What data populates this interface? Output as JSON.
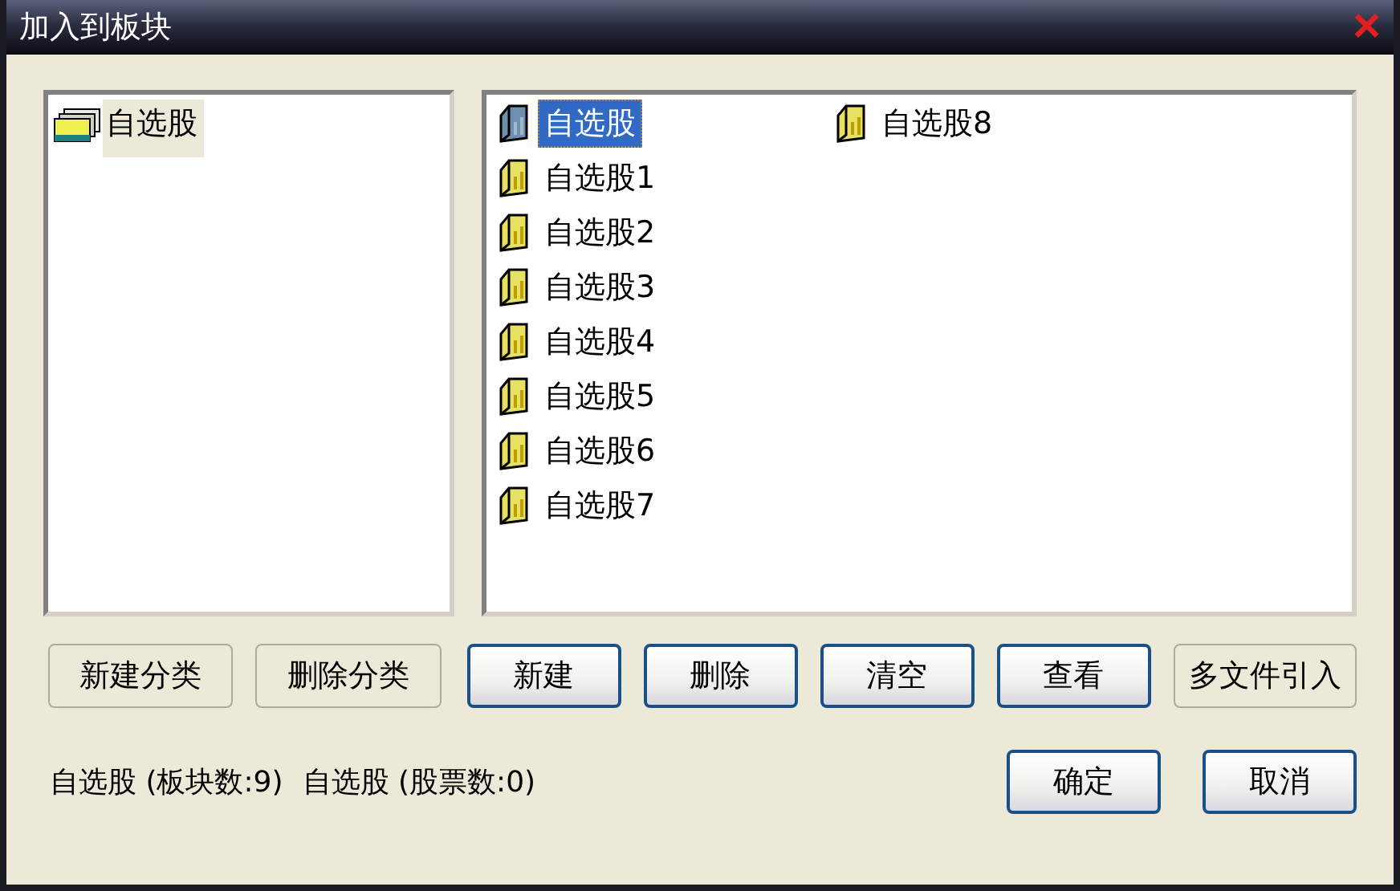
{
  "window": {
    "title": "加入到板块",
    "close": "×"
  },
  "categories": [
    {
      "label": "自选股",
      "selected": true
    }
  ],
  "blocks": [
    {
      "label": "自选股",
      "selected": true
    },
    {
      "label": "自选股1",
      "selected": false
    },
    {
      "label": "自选股2",
      "selected": false
    },
    {
      "label": "自选股3",
      "selected": false
    },
    {
      "label": "自选股4",
      "selected": false
    },
    {
      "label": "自选股5",
      "selected": false
    },
    {
      "label": "自选股6",
      "selected": false
    },
    {
      "label": "自选股7",
      "selected": false
    },
    {
      "label": "自选股8",
      "selected": false
    }
  ],
  "buttons": [
    {
      "label": "新建分类",
      "kind": "flat"
    },
    {
      "label": "删除分类",
      "kind": "flat"
    },
    {
      "label": "新建",
      "kind": "raised"
    },
    {
      "label": "删除",
      "kind": "raised"
    },
    {
      "label": "清空",
      "kind": "raised"
    },
    {
      "label": "查看",
      "kind": "raised"
    },
    {
      "label": "多文件引入",
      "kind": "flat"
    }
  ],
  "status": [
    "自选股 (板块数:9)",
    "自选股 (股票数:0)"
  ],
  "dialog_buttons": [
    "确定",
    "取消"
  ]
}
